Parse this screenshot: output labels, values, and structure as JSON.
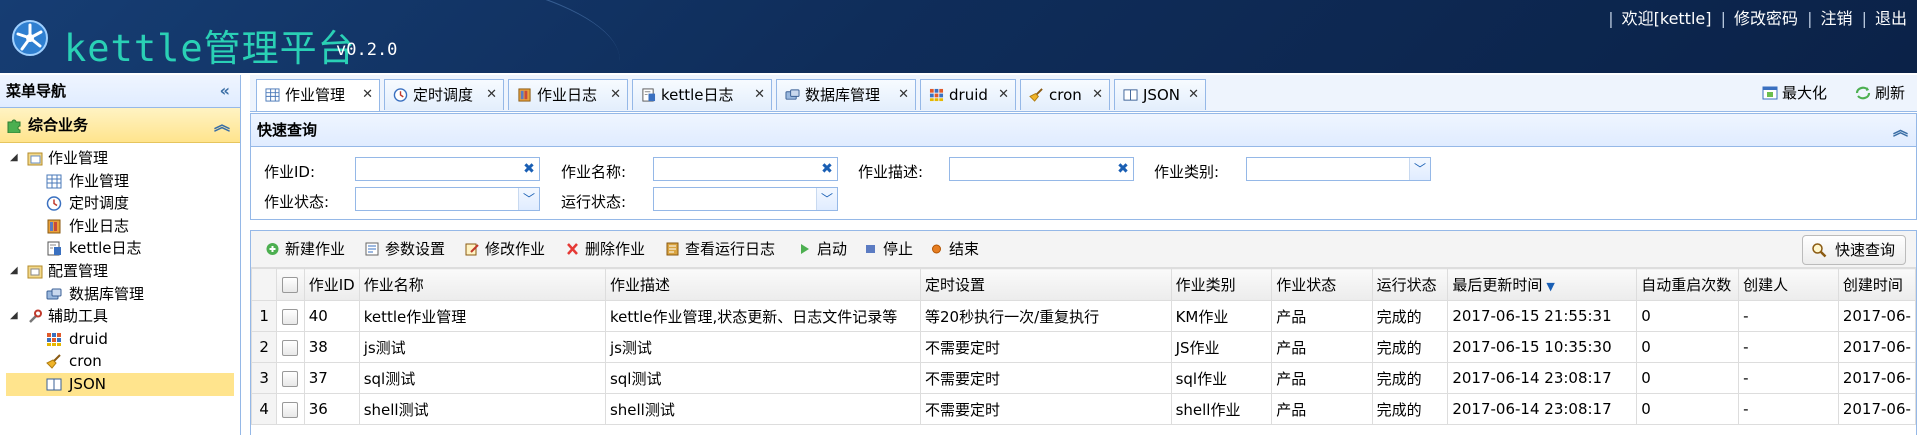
{
  "header": {
    "title": "kettle管理平台",
    "version": "v0.2.0",
    "links": [
      "欢迎[kettle]",
      "修改密码",
      "注销",
      "退出"
    ],
    "bg_color": "#0f2d5a",
    "title_color": "#2ad0b5"
  },
  "sidebar": {
    "title": "菜单导航",
    "group_title": "综合业务",
    "tree": [
      {
        "label": "作业管理",
        "level": 0,
        "icon": "folder-table-icon"
      },
      {
        "label": "作业管理",
        "level": 1,
        "icon": "table-icon"
      },
      {
        "label": "定时调度",
        "level": 1,
        "icon": "clock-icon"
      },
      {
        "label": "作业日志",
        "level": 1,
        "icon": "log-book-icon"
      },
      {
        "label": "kettle日志",
        "level": 1,
        "icon": "kettle-log-icon"
      },
      {
        "label": "配置管理",
        "level": 0,
        "icon": "folder-config-icon"
      },
      {
        "label": "数据库管理",
        "level": 1,
        "icon": "database-icon"
      },
      {
        "label": "辅助工具",
        "level": 0,
        "icon": "wrench-icon"
      },
      {
        "label": "druid",
        "level": 1,
        "icon": "grid-dots-icon"
      },
      {
        "label": "cron",
        "level": 1,
        "icon": "broom-icon"
      },
      {
        "label": "JSON",
        "level": 1,
        "icon": "book-icon"
      }
    ]
  },
  "tabs": [
    {
      "label": "作业管理",
      "icon": "table-icon"
    },
    {
      "label": "定时调度",
      "icon": "clock-icon"
    },
    {
      "label": "作业日志",
      "icon": "log-book-icon"
    },
    {
      "label": "kettle日志",
      "icon": "kettle-log-icon"
    },
    {
      "label": "数据库管理",
      "icon": "database-icon"
    },
    {
      "label": "druid",
      "icon": "grid-dots-icon"
    },
    {
      "label": "cron",
      "icon": "broom-icon"
    },
    {
      "label": "JSON",
      "icon": "book-icon"
    }
  ],
  "tab_tools": {
    "maximize": "最大化",
    "refresh": "刷新"
  },
  "query": {
    "title": "快速查询",
    "fields": {
      "job_id": {
        "label": "作业ID:",
        "value": ""
      },
      "job_name": {
        "label": "作业名称:",
        "value": ""
      },
      "job_desc": {
        "label": "作业描述:",
        "value": ""
      },
      "job_type": {
        "label": "作业类别:",
        "value": ""
      },
      "job_status": {
        "label": "作业状态:",
        "value": ""
      },
      "run_status": {
        "label": "运行状态:",
        "value": ""
      }
    }
  },
  "toolbar": {
    "new_job": "新建作业",
    "params": "参数设置",
    "edit_job": "修改作业",
    "delete_job": "删除作业",
    "view_log": "查看运行日志",
    "start": "启动",
    "stop": "停止",
    "end": "结束",
    "quick_query": "快速查询"
  },
  "table": {
    "columns": [
      "作业ID",
      "作业名称",
      "作业描述",
      "定时设置",
      "作业类别",
      "作业状态",
      "运行状态",
      "最后更新时间",
      "自动重启次数",
      "创建人",
      "创建时间"
    ],
    "rows": [
      {
        "rownum": "1",
        "id": "40",
        "name": "kettle作业管理",
        "desc": "kettle作业管理,状态更新、日志文件记录等",
        "cron": "等20秒执行一次/重复执行",
        "type": "KM作业",
        "status": "产品",
        "run": "完成的",
        "updated": "2017-06-15 21:55:31",
        "restarts": "0",
        "creator": "-",
        "created": "2017-06-"
      },
      {
        "rownum": "2",
        "id": "38",
        "name": "js测试",
        "desc": "js测试",
        "cron": "不需要定时",
        "type": "JS作业",
        "status": "产品",
        "run": "完成的",
        "updated": "2017-06-15 10:35:30",
        "restarts": "0",
        "creator": "-",
        "created": "2017-06-"
      },
      {
        "rownum": "3",
        "id": "37",
        "name": "sql测试",
        "desc": "sql测试",
        "cron": "不需要定时",
        "type": "sql作业",
        "status": "产品",
        "run": "完成的",
        "updated": "2017-06-14 23:08:17",
        "restarts": "0",
        "creator": "-",
        "created": "2017-06-"
      },
      {
        "rownum": "4",
        "id": "36",
        "name": "shell测试",
        "desc": "shell测试",
        "cron": "不需要定时",
        "type": "shell作业",
        "status": "产品",
        "run": "完成的",
        "updated": "2017-06-14 23:08:17",
        "restarts": "0",
        "creator": "-",
        "created": "2017-06-"
      }
    ]
  }
}
